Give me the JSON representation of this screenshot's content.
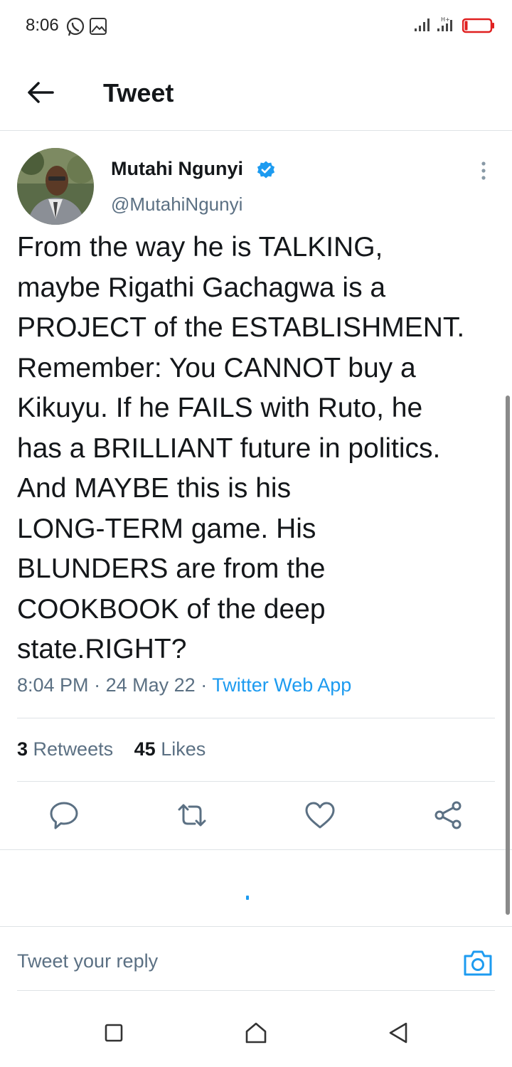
{
  "status_bar": {
    "time": "8:06",
    "icons": [
      "whatsapp-icon",
      "gallery-icon",
      "signal-icon",
      "signal-icon",
      "battery-icon"
    ],
    "battery_color": "#e02020"
  },
  "header": {
    "back_icon": "arrow-left-icon",
    "title": "Tweet"
  },
  "tweet": {
    "author_name": "Mutahi Ngunyi",
    "verified": true,
    "handle": "@MutahiNgunyi",
    "text": "From the way he is TALKING,\nmaybe Rigathi Gachagwa is a\nPROJECT of the ESTABLISHMENT.\nRemember: You CANNOT buy a\nKikuyu. If he FAILS with Ruto, he\nhas a BRILLIANT future in politics.\nAnd MAYBE this is his\nLONG-TERM game. His\nBLUNDERS are from the\nCOOKBOOK of the deep\nstate.RIGHT?",
    "time": "8:04 PM",
    "separator": "·",
    "date": "24 May 22",
    "source": "Twitter Web App",
    "retweets_count": "3",
    "retweets_label": "Retweets",
    "likes_count": "45",
    "likes_label": "Likes"
  },
  "actions": [
    "reply-icon",
    "retweet-icon",
    "like-icon",
    "share-icon"
  ],
  "reply": {
    "placeholder": "Tweet your reply",
    "camera_icon": "camera-icon"
  },
  "nav": [
    "recents-icon",
    "home-icon",
    "back-icon"
  ],
  "colors": {
    "accent": "#1d9bf0",
    "text": "#14171a",
    "secondary_text": "#5b7083",
    "divider": "#dfe3e6"
  }
}
